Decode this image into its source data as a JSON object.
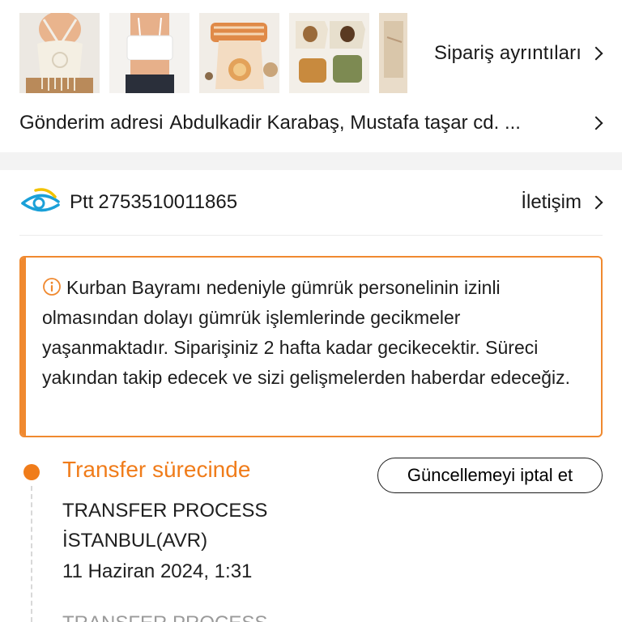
{
  "order": {
    "thumbnails": [
      {
        "name": "crochet-halter-top-image"
      },
      {
        "name": "white-tube-top-image"
      },
      {
        "name": "baby-lion-romper-image"
      },
      {
        "name": "kids-bear-shirt-shorts-set-image"
      },
      {
        "name": "partial-product-image"
      }
    ],
    "details_label": "Sipariş ayrıntıları",
    "address_label": "Gönderim adresi",
    "address_value": "Abdulkadir Karabaş, Mustafa taşar cd. ..."
  },
  "carrier": {
    "name": "Ptt",
    "tracking_number": "2753510011865",
    "contact_label": "İletişim",
    "logo_colors": {
      "blue": "#1aa0d8",
      "yellow": "#f2c200"
    }
  },
  "notice": {
    "text": "Kurban Bayramı nedeniyle gümrük personelinin izinli olmasından dolayı gümrük işlemlerinde gecikmeler yaşanmaktadır. Siparişiniz 2 hafta kadar gecikecektir. Süreci yakından takip edecek ve sizi gelişmelerden haberdar edeceğiz.",
    "accent_color": "#f0892f"
  },
  "timeline": {
    "current_status": "Transfer sürecinde",
    "cancel_button_label": "Güncellemeyi iptal et",
    "events": [
      {
        "description": "TRANSFER PROCESS",
        "location": "İSTANBUL(AVR)",
        "time": "11 Haziran 2024, 1:31"
      },
      {
        "description": "TRANSFER PROCESS"
      }
    ],
    "active_color": "#f07c1a"
  }
}
